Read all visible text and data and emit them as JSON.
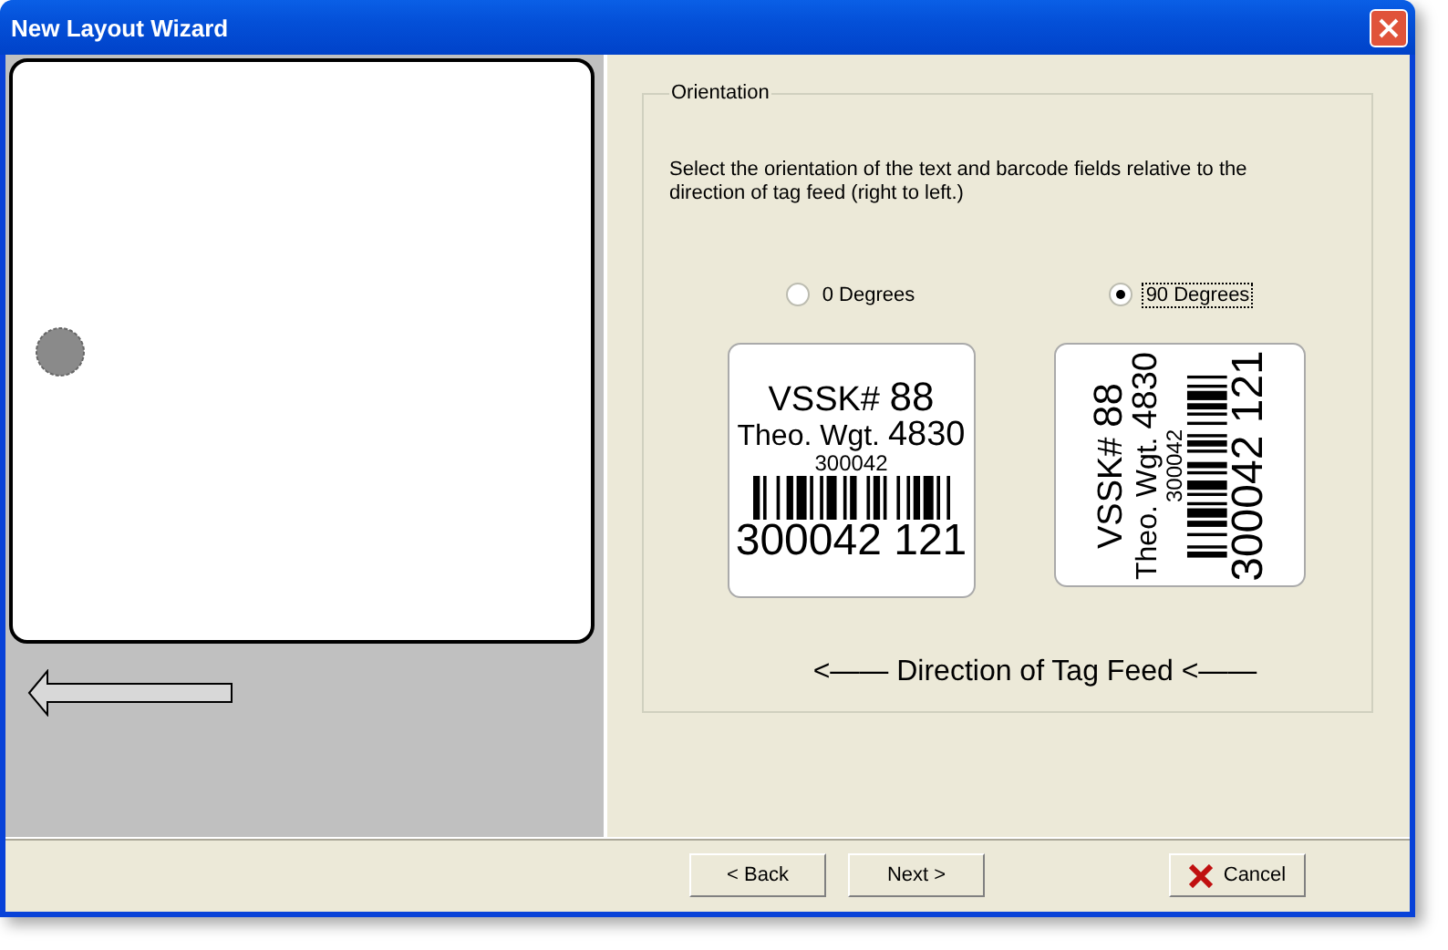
{
  "window": {
    "title": "New Layout Wizard"
  },
  "orientation": {
    "legend": "Orientation",
    "instructions": "Select the orientation of the text and barcode fields relative to the direction of tag feed (right to left.)",
    "options": [
      {
        "label": "0 Degrees",
        "selected": false,
        "kind": "horizontal",
        "tag": {
          "title": "VSSK#",
          "number": "88",
          "weight_label": "Theo. Wgt.",
          "weight": "4830",
          "code": "300042",
          "footer": "300042 121"
        }
      },
      {
        "label": "90 Degrees",
        "selected": true,
        "kind": "vertical",
        "tag": {
          "title": "VSSK#",
          "number": "88",
          "weight_label": "Theo. Wgt.",
          "weight": "4830",
          "code": "300042",
          "footer": "300042 121"
        }
      }
    ],
    "caption": "<—— Direction of Tag Feed <——"
  },
  "buttons": [
    {
      "label": "< Back",
      "kind": "plain"
    },
    {
      "label": "Next >",
      "kind": "plain"
    },
    {
      "label": "Cancel",
      "kind": "cancel"
    }
  ]
}
